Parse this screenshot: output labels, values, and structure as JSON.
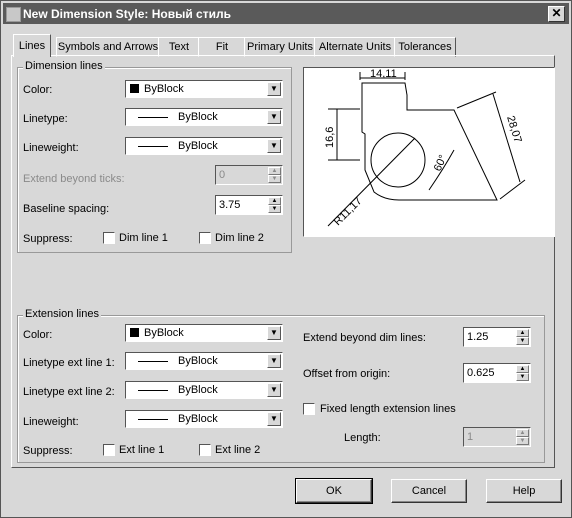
{
  "window": {
    "title": "New Dimension Style: Новый стиль",
    "close": "✕"
  },
  "tabs": [
    "Lines",
    "Symbols and Arrows",
    "Text",
    "Fit",
    "Primary Units",
    "Alternate Units",
    "Tolerances"
  ],
  "dimension_lines": {
    "title": "Dimension lines",
    "color_label": "Color:",
    "color_value": "ByBlock",
    "linetype_label": "Linetype:",
    "linetype_value": "ByBlock",
    "lineweight_label": "Lineweight:",
    "lineweight_value": "ByBlock",
    "extend_label": "Extend beyond ticks:",
    "extend_value": "0",
    "baseline_label": "Baseline spacing:",
    "baseline_value": "3.75",
    "suppress_label": "Suppress:",
    "dim_line1": "Dim line 1",
    "dim_line2": "Dim line 2"
  },
  "preview": {
    "top_dim": "14,11",
    "left_dim": "16,6",
    "right_dim": "28,07",
    "angle_dim": "60°",
    "radius_dim": "R11,17"
  },
  "extension_lines": {
    "title": "Extension lines",
    "color_label": "Color:",
    "color_value": "ByBlock",
    "lt1_label": "Linetype ext line 1:",
    "lt1_value": "ByBlock",
    "lt2_label": "Linetype ext line 2:",
    "lt2_value": "ByBlock",
    "lineweight_label": "Lineweight:",
    "lineweight_value": "ByBlock",
    "suppress_label": "Suppress:",
    "ext_line1": "Ext line 1",
    "ext_line2": "Ext line 2",
    "extend_label": "Extend beyond dim lines:",
    "extend_value": "1.25",
    "offset_label": "Offset from origin:",
    "offset_value": "0.625",
    "fixed_label": "Fixed length extension lines",
    "length_label": "Length:",
    "length_value": "1"
  },
  "buttons": {
    "ok": "OK",
    "cancel": "Cancel",
    "help": "Help"
  }
}
